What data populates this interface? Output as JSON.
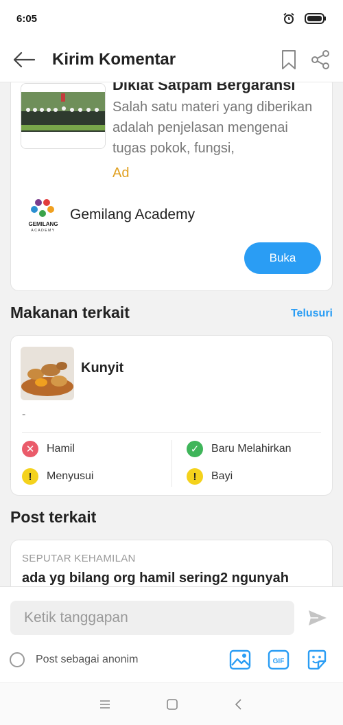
{
  "status": {
    "time": "6:05"
  },
  "header": {
    "title": "Kirim Komentar"
  },
  "ad": {
    "title": "Diklat Satpam Bergaransi",
    "description": "Salah satu materi yang diberikan adalah penjelasan mengenai tugas pokok, fungsi,",
    "tag": "Ad",
    "advertiser": "Gemilang Academy",
    "logo_text": "GEMILANG",
    "logo_subtext": "ACADEMY",
    "open_label": "Buka"
  },
  "related_food": {
    "title": "Makanan terkait",
    "link": "Telusuri",
    "item": {
      "name": "Kunyit",
      "note": "-",
      "safety": [
        {
          "label": "Hamil",
          "status": "no"
        },
        {
          "label": "Baru Melahirkan",
          "status": "yes"
        },
        {
          "label": "Menyusui",
          "status": "warn"
        },
        {
          "label": "Bayi",
          "status": "warn"
        }
      ]
    }
  },
  "related_post": {
    "title": "Post terkait",
    "category": "SEPUTAR KEHAMILAN",
    "text": "ada yg bilang org hamil sering2 ngunyah"
  },
  "composer": {
    "placeholder": "Ketik tanggapan",
    "anon_label": "Post sebagai anonim"
  },
  "colors": {
    "accent": "#2a9df4",
    "no": "#ea5b6a",
    "yes": "#3fb55a",
    "warn": "#f4d21c",
    "ad_tag": "#e0a020"
  }
}
